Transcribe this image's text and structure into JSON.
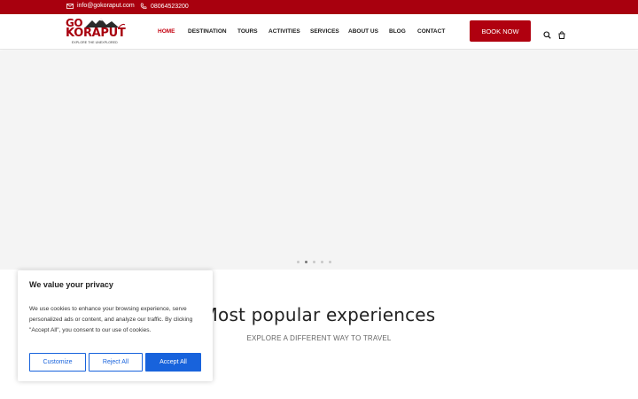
{
  "topbar": {
    "email": "info@gokoraput.com",
    "phone": "08064523200",
    "bg_color": "#a8000e"
  },
  "brand": {
    "line1": "GO",
    "line2": "KORAPUT",
    "tagline": "EXPLORE THE UNEXPLORED",
    "color": "#a8000e"
  },
  "nav": {
    "items": [
      {
        "label": "HOME",
        "active": true
      },
      {
        "label": "DESTINATION",
        "active": false
      },
      {
        "label": "TOURS",
        "active": false
      },
      {
        "label": "ACTIVITIES",
        "active": false
      },
      {
        "label": "SERVICES",
        "active": false
      },
      {
        "label": "ABOUT US",
        "active": false
      },
      {
        "label": "BLOG",
        "active": false
      },
      {
        "label": "CONTACT",
        "active": false
      }
    ],
    "book_label": "BOOK NOW"
  },
  "hero": {
    "slides_count": 5,
    "active_slide": 2
  },
  "section": {
    "title": "Most popular experiences",
    "subtitle": "EXPLORE A DIFFERENT WAY TO TRAVEL"
  },
  "cookie": {
    "title": "We value your privacy",
    "body": "We use cookies to enhance your browsing experience, serve personalized ads or content, and analyze our traffic. By clicking \"Accept All\", you consent to our use of cookies.",
    "customize_label": "Customize",
    "reject_label": "Reject All",
    "accept_label": "Accept All",
    "accent": "#1863dc"
  }
}
